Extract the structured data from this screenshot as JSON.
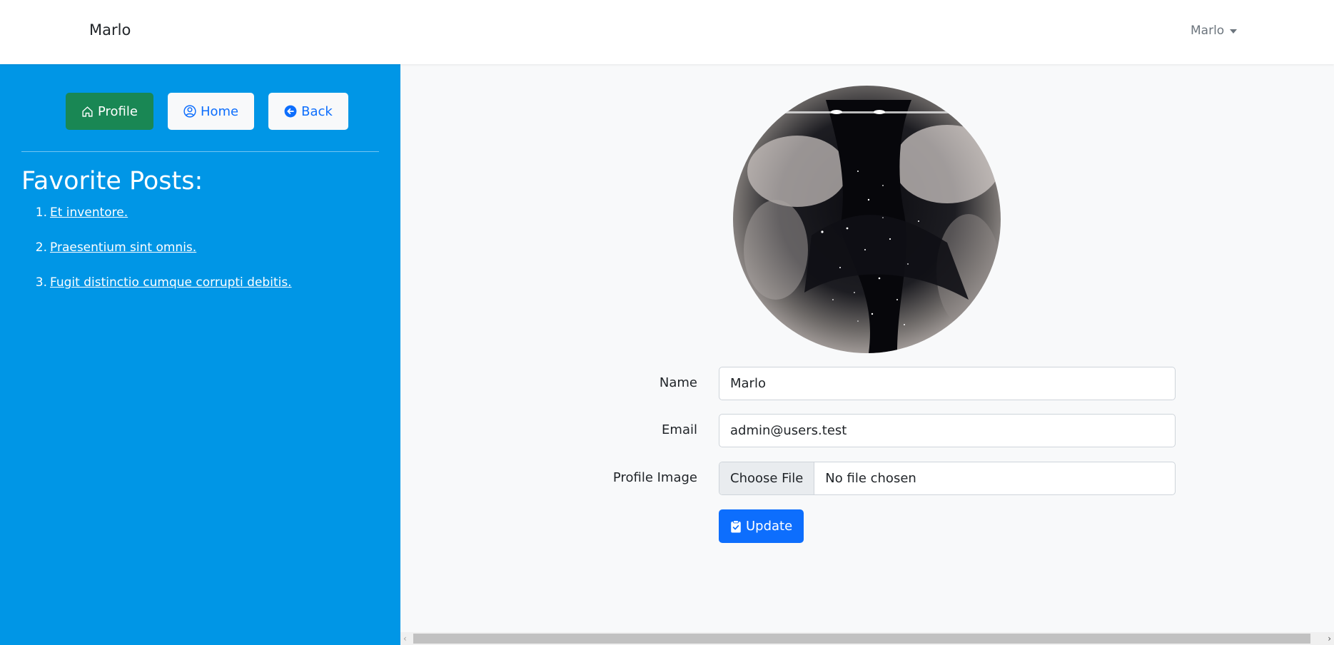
{
  "navbar": {
    "brand": "Marlo",
    "user_menu_label": "Marlo"
  },
  "sidebar": {
    "buttons": [
      {
        "label": "Profile",
        "icon": "house-icon"
      },
      {
        "label": "Home",
        "icon": "person-circle-icon"
      },
      {
        "label": "Back",
        "icon": "arrow-left-circle-icon"
      }
    ],
    "favorites_title": "Favorite Posts:",
    "favorites": [
      {
        "num": "1.",
        "title": "Et inventore."
      },
      {
        "num": "2.",
        "title": "Praesentium sint omnis."
      },
      {
        "num": "3.",
        "title": "Fugit distinctio cumque corrupti debitis."
      }
    ]
  },
  "form": {
    "name_label": "Name",
    "name_value": "Marlo",
    "email_label": "Email",
    "email_value": "admin@users.test",
    "image_label": "Profile Image",
    "file_button": "Choose File",
    "file_status": "No file chosen",
    "submit_label": "Update",
    "submit_icon": "clipboard-check-icon"
  },
  "colors": {
    "sidebar_bg": "#0096e6",
    "success": "#198754",
    "primary": "#0d6efd",
    "page_bg": "#f8f9fa"
  }
}
